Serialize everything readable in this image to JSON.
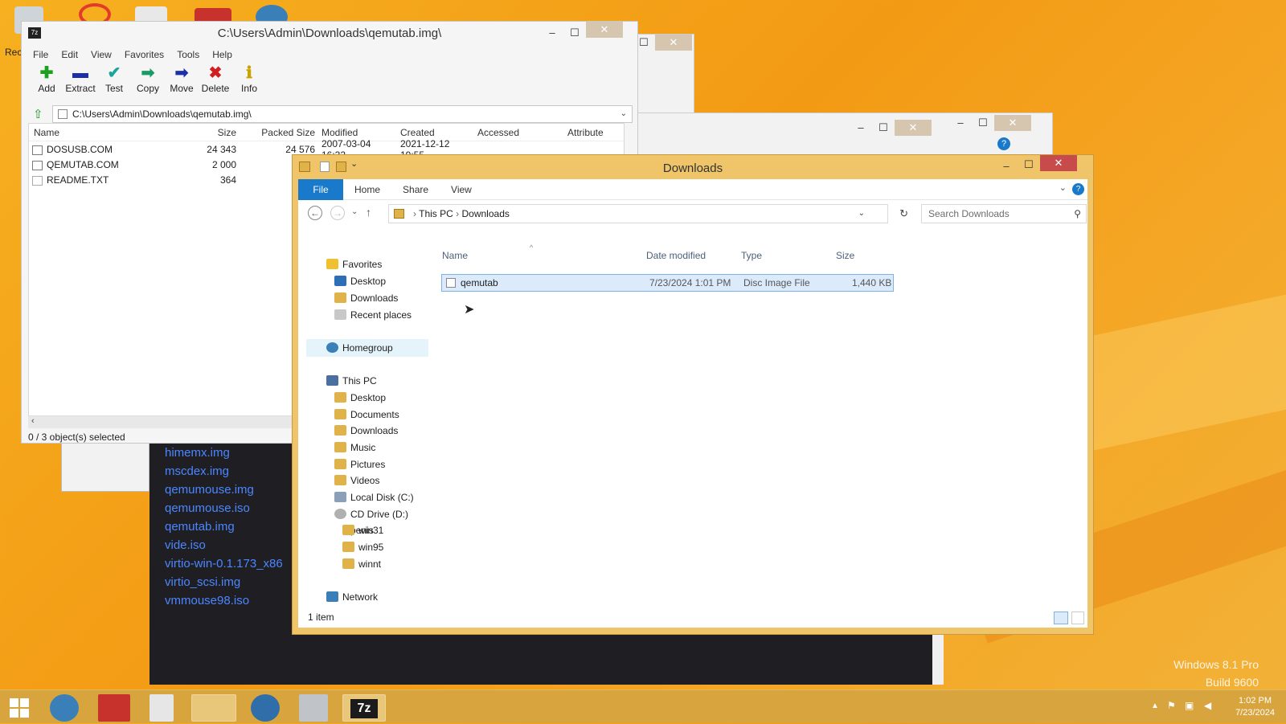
{
  "desktop": {
    "watermark_line1": "Windows 8.1 Pro",
    "watermark_line2": "Build 9600",
    "partial_label": "Rec"
  },
  "background_app": {
    "files": [
      "himemx.img",
      "mscdex.img",
      "qemumouse.img",
      "qemumouse.iso",
      "qemutab.img",
      "vide.iso",
      "virtio-win-0.1.173_x86",
      "virtio_scsi.img",
      "vmmouse98.iso"
    ]
  },
  "sevenzip": {
    "title": "C:\\Users\\Admin\\Downloads\\qemutab.img\\",
    "app_icon": "7z",
    "menu": [
      "File",
      "Edit",
      "View",
      "Favorites",
      "Tools",
      "Help"
    ],
    "toolbar": [
      {
        "label": "Add",
        "icon": "plus-icon",
        "glyph": "✚",
        "color": "#1da01d"
      },
      {
        "label": "Extract",
        "icon": "minus-icon",
        "glyph": "▬",
        "color": "#1b2fa8"
      },
      {
        "label": "Test",
        "icon": "check-icon",
        "glyph": "✔",
        "color": "#1aa59a"
      },
      {
        "label": "Copy",
        "icon": "copy-arrow-icon",
        "glyph": "➡",
        "color": "#1a9a66"
      },
      {
        "label": "Move",
        "icon": "move-arrow-icon",
        "glyph": "➡",
        "color": "#1b2fa8"
      },
      {
        "label": "Delete",
        "icon": "delete-x-icon",
        "glyph": "✖",
        "color": "#d11e1e"
      },
      {
        "label": "Info",
        "icon": "info-icon",
        "glyph": "ℹ",
        "color": "#c9a100"
      }
    ],
    "address": "C:\\Users\\Admin\\Downloads\\qemutab.img\\",
    "columns": {
      "name": "Name",
      "size": "Size",
      "packed": "Packed Size",
      "modified": "Modified",
      "created": "Created",
      "accessed": "Accessed",
      "attributes": "Attribute"
    },
    "files": [
      {
        "name": "DOSUSB.COM",
        "size": "24 343",
        "packed": "24 576",
        "modified": "2007-03-04 16:32",
        "created": "2021-12-12 19:55"
      },
      {
        "name": "QEMUTAB.COM",
        "size": "2 000",
        "packed": "",
        "modified": "",
        "created": ""
      },
      {
        "name": "README.TXT",
        "size": "364",
        "packed": "",
        "modified": "",
        "created": ""
      }
    ],
    "status": "0 / 3 object(s) selected"
  },
  "explorer": {
    "title": "Downloads",
    "ribbon_tabs": [
      "File",
      "Home",
      "Share",
      "View"
    ],
    "breadcrumb": [
      "This PC",
      "Downloads"
    ],
    "search_placeholder": "Search Downloads",
    "nav": {
      "favorites": "Favorites",
      "fav_items": [
        "Desktop",
        "Downloads",
        "Recent places"
      ],
      "homegroup": "Homegroup",
      "thispc": "This PC",
      "pc_items": [
        "Desktop",
        "Documents",
        "Downloads",
        "Music",
        "Pictures",
        "Videos",
        "Local Disk (C:)",
        "CD Drive (D:) penis"
      ],
      "cd_items": [
        "win31",
        "win95",
        "winnt"
      ],
      "network": "Network"
    },
    "columns": {
      "name": "Name",
      "date": "Date modified",
      "type": "Type",
      "size": "Size"
    },
    "file": {
      "name": "qemutab",
      "date": "7/23/2024 1:01 PM",
      "type": "Disc Image File",
      "size": "1,440 KB"
    },
    "status": "1 item"
  },
  "taskbar": {
    "time": "1:02 PM",
    "date": "7/23/2024",
    "sevenzip_label": "7z"
  }
}
